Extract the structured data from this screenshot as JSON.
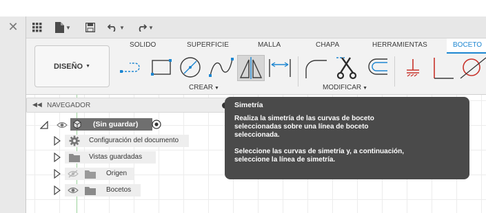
{
  "window": {
    "close_glyph": "✕"
  },
  "toolbar": {
    "icons": [
      "grid-menu-icon",
      "file-icon",
      "save-icon",
      "undo-icon",
      "redo-icon"
    ],
    "caret": "▼"
  },
  "ribbon": {
    "workspace_label": "DISEÑO",
    "tabs": [
      "SOLIDO",
      "SUPERFICIE",
      "MALLA",
      "CHAPA",
      "HERRAMIENTAS",
      "BOCETO"
    ],
    "active_tab": "BOCETO",
    "groups": {
      "create": "CREAR",
      "modify": "MODIFICAR"
    },
    "accent_color": "#1c86d1",
    "sketch_red": "#c8332b"
  },
  "navigator": {
    "title": "NAVEGADOR",
    "root_label": "(Sin guardar)",
    "items": [
      {
        "label": "Configuración del documento",
        "icon": "gear-icon"
      },
      {
        "label": "Vistas guardadas",
        "icon": "folder-icon"
      },
      {
        "label": "Origen",
        "icon": "folder-icon"
      },
      {
        "label": "Bocetos",
        "icon": "folder-icon"
      }
    ]
  },
  "tooltip": {
    "title": "Simetría",
    "line1": "Realiza la simetría de las curvas de boceto",
    "line2": "seleccionadas sobre una línea de boceto",
    "line3": "seleccionada.",
    "line4": "Seleccione las curvas de simetría y, a continuación,",
    "line5": "seleccione la línea de simetría."
  }
}
